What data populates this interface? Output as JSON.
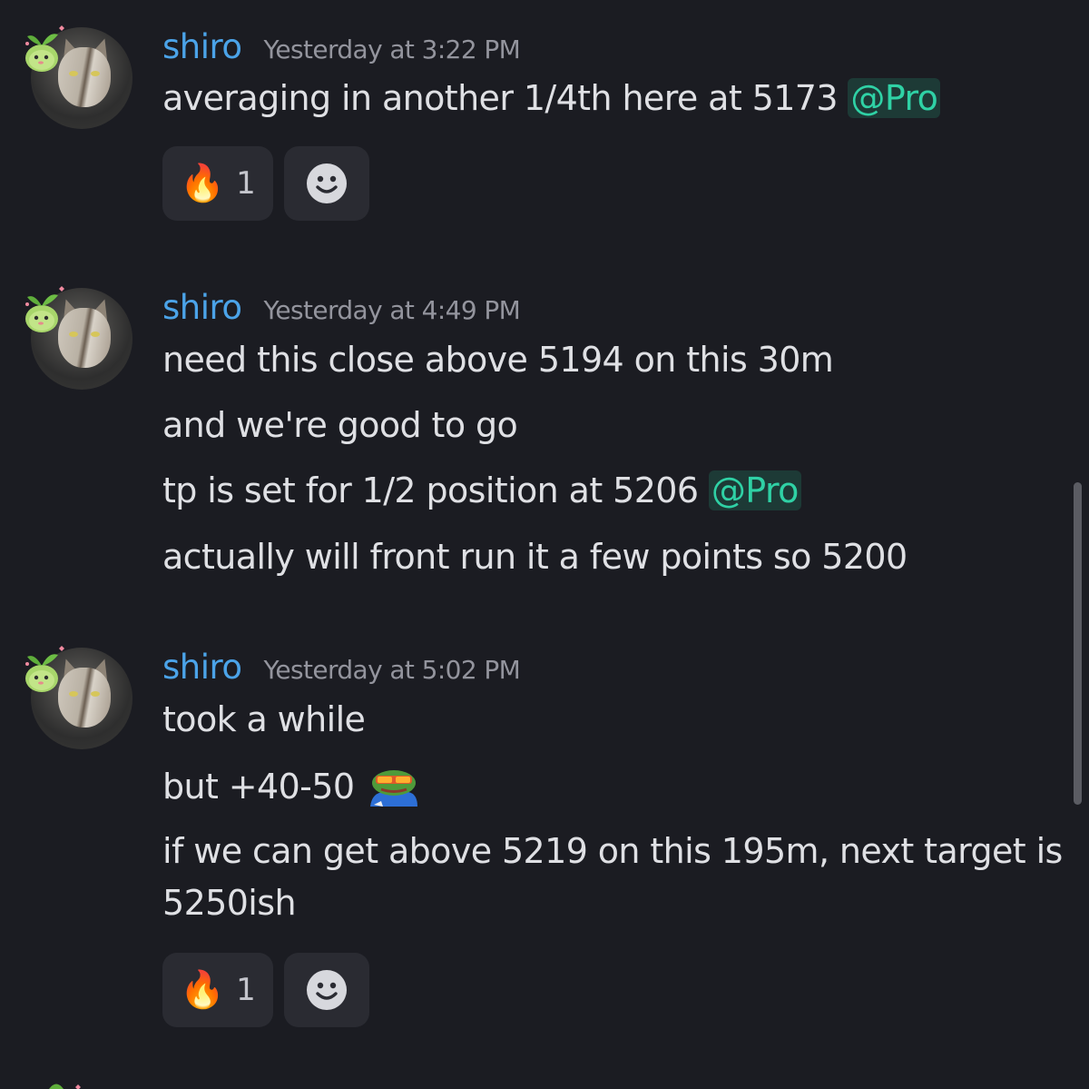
{
  "colors": {
    "background": "#1b1c22",
    "username": "#4ba3e8",
    "timestamp": "#93949d",
    "text": "#dfe0e4",
    "mention_text": "#2fd1a5",
    "mention_bg": "#1d3a36",
    "reaction_bg": "#2a2b32"
  },
  "messages": [
    {
      "author": "shiro",
      "timestamp": "Yesterday at 3:22 PM",
      "avatar_icon": "cat-avatar",
      "lines": [
        {
          "text": "averaging in another 1/4th here at 5173 ",
          "mention": "@Pro"
        }
      ],
      "reactions": [
        {
          "emoji": "🔥",
          "icon": "fire-emoji",
          "count": "1"
        }
      ],
      "add_reaction_icon": "smiley-icon"
    },
    {
      "author": "shiro",
      "timestamp": "Yesterday at 4:49 PM",
      "avatar_icon": "cat-avatar",
      "lines": [
        {
          "text": "need this close above 5194 on this 30m"
        },
        {
          "text": "and we're good to go"
        },
        {
          "text": "tp is set for 1/2 position at 5206 ",
          "mention": "@Pro"
        },
        {
          "text": "actually will front run it a few points so 5200"
        }
      ]
    },
    {
      "author": "shiro",
      "timestamp": "Yesterday at 5:02 PM",
      "avatar_icon": "cat-avatar",
      "lines": [
        {
          "text": "took a while"
        },
        {
          "text": "but +40-50 ",
          "emoji_icon": "pepe-sunglasses-emoji"
        },
        {
          "text": "if we can get above 5219 on this 195m, next target is"
        },
        {
          "text": "5250ish"
        }
      ],
      "reactions": [
        {
          "emoji": "🔥",
          "icon": "fire-emoji",
          "count": "1"
        }
      ],
      "add_reaction_icon": "smiley-icon"
    }
  ]
}
